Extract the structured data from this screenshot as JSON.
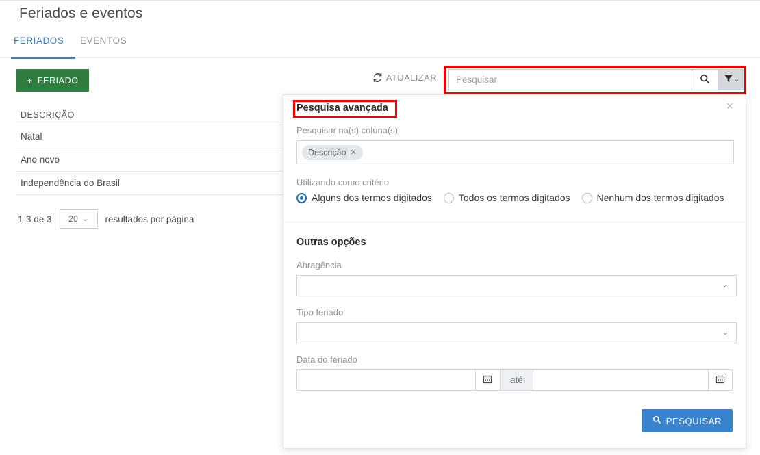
{
  "page": {
    "title": "Feriados e eventos"
  },
  "tabs": [
    {
      "label": "FERIADOS",
      "active": true
    },
    {
      "label": "EVENTOS",
      "active": false
    }
  ],
  "toolbar": {
    "new_button_label": "FERIADO",
    "new_button_plus": "+",
    "refresh_label": "ATUALIZAR",
    "refresh_icon": "refresh-icon",
    "search_placeholder": "Pesquisar",
    "search_value": "",
    "search_icon": "search-icon",
    "filter_icon": "funnel-icon",
    "filter_chevron": "⌄"
  },
  "table": {
    "columns": [
      "DESCRIÇÃO"
    ],
    "rows": [
      {
        "descricao": "Natal"
      },
      {
        "descricao": "Ano novo"
      },
      {
        "descricao": "Independência do Brasil"
      }
    ]
  },
  "pagination": {
    "range_label": "1-3 de 3",
    "per_page_value": "20",
    "per_page_chevron": "⌄",
    "per_page_label": "resultados por página"
  },
  "advanced_panel": {
    "title": "Pesquisa avançada",
    "close_label": "×",
    "columns_label": "Pesquisar na(s) coluna(s)",
    "columns_chips": [
      {
        "label": "Descrição",
        "remove": "✕"
      }
    ],
    "criteria_label": "Utilizando como critério",
    "criteria_options": [
      {
        "label": "Alguns dos termos digitados",
        "selected": true
      },
      {
        "label": "Todos os termos digitados",
        "selected": false
      },
      {
        "label": "Nenhum dos termos digitados",
        "selected": false
      }
    ],
    "other_options_heading": "Outras opções",
    "scope_label": "Abragência",
    "scope_value": "",
    "scope_chevron": "⌄",
    "holiday_type_label": "Tipo feriado",
    "holiday_type_value": "",
    "holiday_type_chevron": "⌄",
    "date_label": "Data do feriado",
    "date_from_value": "",
    "date_to_value": "",
    "date_separator": "até",
    "calendar_icon": "calendar-icon",
    "submit_label": "PESQUISAR",
    "submit_icon": "search-icon"
  },
  "annotations": {
    "highlight_search_group": "red-highlight-box",
    "highlight_panel_title": "red-highlight-box"
  },
  "colors": {
    "accent_blue": "#3d7fc1",
    "primary_green": "#2f7d3f",
    "submit_blue": "#3a84cd",
    "annotation_red": "#ee0000",
    "chip_gray": "#e4e7ea"
  }
}
